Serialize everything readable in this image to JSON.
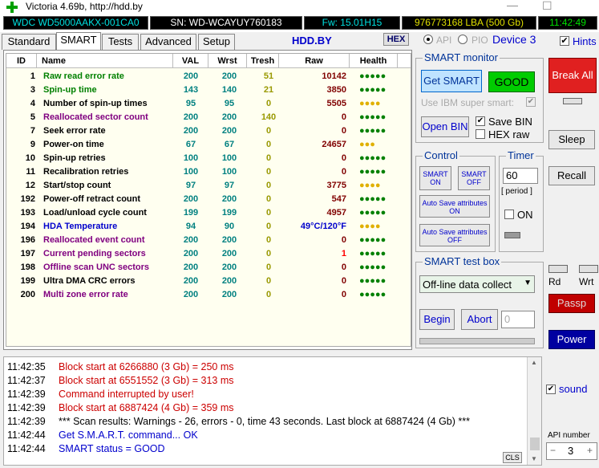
{
  "window": {
    "title": "Victoria 4.69b, http://hdd.by",
    "minimize": "—",
    "maximize": "☐"
  },
  "info": {
    "model": "WDC WD5000AAKX-001CA0",
    "serial": "SN: WD-WCAYUY760183",
    "firmware": "Fw: 15.01H15",
    "lba": "976773168 LBA (500 Gb)",
    "time": "11:42:49"
  },
  "tabs": [
    "Standard",
    "SMART",
    "Tests",
    "Advanced",
    "Setup"
  ],
  "site": "HDD.BY",
  "hex_label": "HEX",
  "mode": {
    "api": "API",
    "pio": "PIO",
    "device": "Device 3"
  },
  "hints_label": "Hints",
  "table": {
    "headers": [
      "ID",
      "Name",
      "VAL",
      "Wrst",
      "Tresh",
      "Raw",
      "Health"
    ],
    "rows": [
      {
        "id": "1",
        "name": "Raw read error rate",
        "val": "200",
        "wrst": "200",
        "tresh": "51",
        "raw": "10142",
        "health": "●●●●●",
        "name_color": "#008000",
        "health_color": "#008000"
      },
      {
        "id": "3",
        "name": "Spin-up time",
        "val": "143",
        "wrst": "140",
        "tresh": "21",
        "raw": "3850",
        "health": "●●●●●",
        "name_color": "#008000",
        "health_color": "#008000"
      },
      {
        "id": "4",
        "name": "Number of spin-up times",
        "val": "95",
        "wrst": "95",
        "tresh": "0",
        "raw": "5505",
        "health": "●●●●",
        "name_color": "#000000",
        "health_color": "#e0b000"
      },
      {
        "id": "5",
        "name": "Reallocated sector count",
        "val": "200",
        "wrst": "200",
        "tresh": "140",
        "raw": "0",
        "health": "●●●●●",
        "name_color": "#800080",
        "health_color": "#008000"
      },
      {
        "id": "7",
        "name": "Seek error rate",
        "val": "200",
        "wrst": "200",
        "tresh": "0",
        "raw": "0",
        "health": "●●●●●",
        "name_color": "#000000",
        "health_color": "#008000"
      },
      {
        "id": "9",
        "name": "Power-on time",
        "val": "67",
        "wrst": "67",
        "tresh": "0",
        "raw": "24657",
        "health": "●●●",
        "name_color": "#000000",
        "health_color": "#e0b000"
      },
      {
        "id": "10",
        "name": "Spin-up retries",
        "val": "100",
        "wrst": "100",
        "tresh": "0",
        "raw": "0",
        "health": "●●●●●",
        "name_color": "#000000",
        "health_color": "#008000"
      },
      {
        "id": "11",
        "name": "Recalibration retries",
        "val": "100",
        "wrst": "100",
        "tresh": "0",
        "raw": "0",
        "health": "●●●●●",
        "name_color": "#000000",
        "health_color": "#008000"
      },
      {
        "id": "12",
        "name": "Start/stop count",
        "val": "97",
        "wrst": "97",
        "tresh": "0",
        "raw": "3775",
        "health": "●●●●",
        "name_color": "#000000",
        "health_color": "#e0b000"
      },
      {
        "id": "192",
        "name": "Power-off retract count",
        "val": "200",
        "wrst": "200",
        "tresh": "0",
        "raw": "547",
        "health": "●●●●●",
        "name_color": "#000000",
        "health_color": "#008000"
      },
      {
        "id": "193",
        "name": "Load/unload cycle count",
        "val": "199",
        "wrst": "199",
        "tresh": "0",
        "raw": "4957",
        "health": "●●●●●",
        "name_color": "#000000",
        "health_color": "#008000"
      },
      {
        "id": "194",
        "name": "HDA Temperature",
        "val": "94",
        "wrst": "90",
        "tresh": "0",
        "raw": "49°C/120°F",
        "health": "●●●●",
        "name_color": "#0000cc",
        "health_color": "#e0b000",
        "raw_color": "#0000cc"
      },
      {
        "id": "196",
        "name": "Reallocated event count",
        "val": "200",
        "wrst": "200",
        "tresh": "0",
        "raw": "0",
        "health": "●●●●●",
        "name_color": "#800080",
        "health_color": "#008000"
      },
      {
        "id": "197",
        "name": "Current pending sectors",
        "val": "200",
        "wrst": "200",
        "tresh": "0",
        "raw": "1",
        "health": "●●●●●",
        "name_color": "#800080",
        "health_color": "#008000",
        "raw_color": "#ff0000"
      },
      {
        "id": "198",
        "name": "Offline scan UNC sectors",
        "val": "200",
        "wrst": "200",
        "tresh": "0",
        "raw": "0",
        "health": "●●●●●",
        "name_color": "#800080",
        "health_color": "#008000"
      },
      {
        "id": "199",
        "name": "Ultra DMA CRC errors",
        "val": "200",
        "wrst": "200",
        "tresh": "0",
        "raw": "0",
        "health": "●●●●●",
        "name_color": "#000000",
        "health_color": "#008000"
      },
      {
        "id": "200",
        "name": "Multi zone error rate",
        "val": "200",
        "wrst": "200",
        "tresh": "0",
        "raw": "0",
        "health": "●●●●●",
        "name_color": "#800080",
        "health_color": "#008000"
      }
    ]
  },
  "smart_monitor": {
    "title": "SMART monitor",
    "get_smart": "Get SMART",
    "status": "GOOD",
    "ibm_label": "Use IBM super smart:",
    "open_bin": "Open BIN",
    "save_bin": "Save BIN",
    "hex_raw": "HEX raw"
  },
  "control": {
    "title": "Control",
    "smart_on": "SMART ON",
    "smart_off": "SMART OFF",
    "autosave_on": "Auto Save attributes ON",
    "autosave_off": "Auto Save attributes OFF"
  },
  "timer": {
    "title": "Timer",
    "value": "60",
    "period": "[ period ]",
    "on_label": "ON"
  },
  "test_box": {
    "title": "SMART test box",
    "selected": "Off-line data collect",
    "begin": "Begin",
    "abort": "Abort",
    "value": "0"
  },
  "right": {
    "break_all": "Break All",
    "sleep": "Sleep",
    "recall": "Recall",
    "rd": "Rd",
    "wrt": "Wrt",
    "passp": "Passp",
    "power": "Power",
    "sound": "sound",
    "api_number": "API number",
    "api_value": "3",
    "minus": "−",
    "plus": "+"
  },
  "log": {
    "clear": "CLS",
    "lines": [
      {
        "time": "11:42:35",
        "msg": "Block start at 6266880 (3 Gb)  = 250 ms",
        "color": "#cc0000"
      },
      {
        "time": "11:42:37",
        "msg": "Block start at 6551552 (3 Gb)  = 313 ms",
        "color": "#cc0000"
      },
      {
        "time": "11:42:39",
        "msg": "Command interrupted by user!",
        "color": "#cc0000"
      },
      {
        "time": "11:42:39",
        "msg": "Block start at 6887424 (4 Gb)  = 359 ms",
        "color": "#cc0000"
      },
      {
        "time": "11:42:39",
        "msg": "*** Scan results: Warnings - 26, errors - 0, time 43 seconds. Last block at 6887424 (4 Gb) ***",
        "color": "#000000"
      },
      {
        "time": "11:42:44",
        "msg": "Get S.M.A.R.T. command... OK",
        "color": "#0000cc"
      },
      {
        "time": "11:42:44",
        "msg": "SMART status = GOOD",
        "color": "#0000cc"
      }
    ]
  }
}
